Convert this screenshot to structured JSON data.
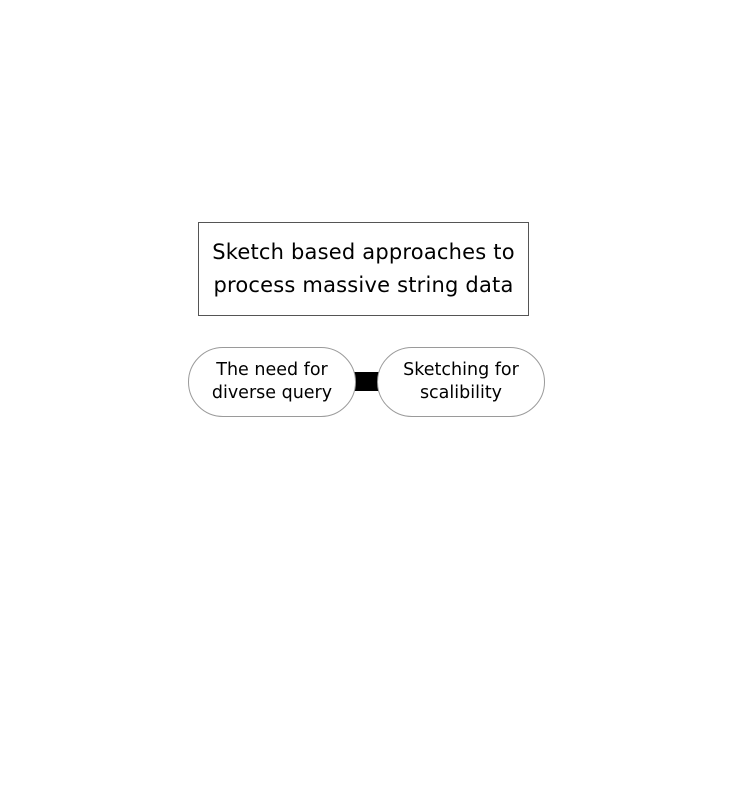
{
  "diagram": {
    "root": {
      "line1": "Sketch based approaches to",
      "line2": "process massive string data"
    },
    "children": [
      {
        "line1": "The need for",
        "line2": "diverse query"
      },
      {
        "line1": "Sketching for",
        "line2": "scalibility"
      }
    ]
  }
}
